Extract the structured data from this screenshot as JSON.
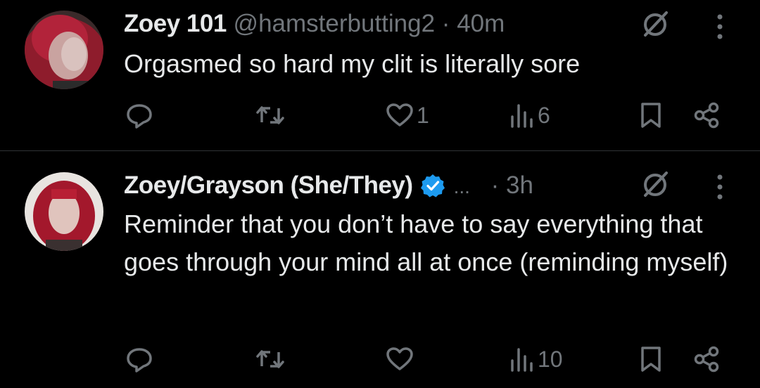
{
  "colors": {
    "background": "#000000",
    "primary_text": "#e7e9ea",
    "secondary_text": "#71767b",
    "divider": "#2f3336",
    "verified_badge": "#1d9bf0"
  },
  "tweets": [
    {
      "display_name": "Zoey 101",
      "handle": "@hamsterbutting2",
      "separator": "·",
      "time": "40m",
      "verified": false,
      "text": "Orgasmed so hard my clit is literally sore",
      "likes": "1",
      "views": "6",
      "icons": {
        "reply": "reply-icon",
        "repost": "repost-icon",
        "like": "heart-icon",
        "views": "views-icon",
        "bookmark": "bookmark-icon",
        "share": "share-icon",
        "grok": "grok-icon",
        "more": "more-icon"
      }
    },
    {
      "display_name": "Zoey/Grayson (She/They)",
      "handle_truncated": "...",
      "separator": "·",
      "time": "3h",
      "verified": true,
      "text": "Reminder that you don’t have to say everything that goes through your mind all at once (reminding myself)",
      "views": "10",
      "icons": {
        "reply": "reply-icon",
        "repost": "repost-icon",
        "like": "heart-icon",
        "views": "views-icon",
        "bookmark": "bookmark-icon",
        "share": "share-icon",
        "grok": "grok-icon",
        "more": "more-icon",
        "verified": "verified-badge-icon"
      }
    }
  ]
}
